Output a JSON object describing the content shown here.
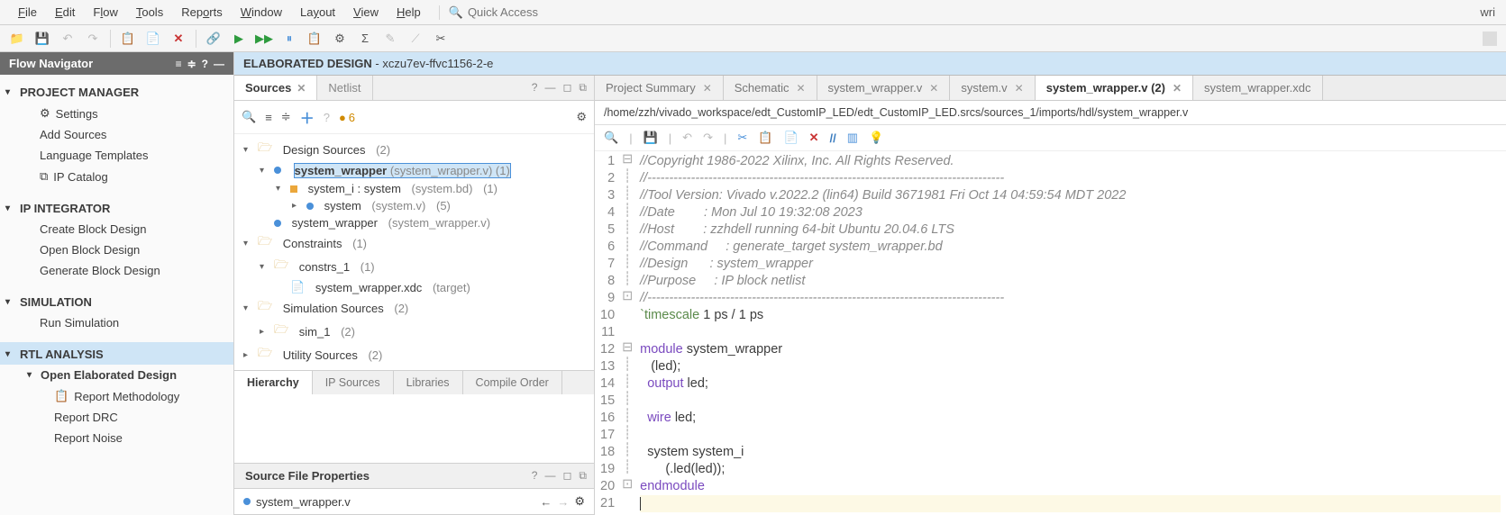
{
  "menu": {
    "file": "File",
    "edit": "Edit",
    "flow": "Flow",
    "tools": "Tools",
    "reports": "Reports",
    "window": "Window",
    "layout": "Layout",
    "view": "View",
    "help": "Help"
  },
  "quick_access": {
    "placeholder": "Quick Access"
  },
  "right_text": "wri",
  "flow_nav": {
    "title": "Flow Navigator",
    "project_manager": "PROJECT MANAGER",
    "settings": "Settings",
    "add_sources": "Add Sources",
    "language_templates": "Language Templates",
    "ip_catalog": "IP Catalog",
    "ip_integrator": "IP INTEGRATOR",
    "create_block": "Create Block Design",
    "open_block": "Open Block Design",
    "generate_block": "Generate Block Design",
    "simulation": "SIMULATION",
    "run_simulation": "Run Simulation",
    "rtl_analysis": "RTL ANALYSIS",
    "open_elab": "Open Elaborated Design",
    "report_methodology": "Report Methodology",
    "report_drc": "Report DRC",
    "report_noise": "Report Noise"
  },
  "elab": {
    "title": "ELABORATED DESIGN",
    "part": " - xczu7ev-ffvc1156-2-e"
  },
  "sources": {
    "tab": "Sources",
    "netlist": "Netlist",
    "warn_count": "6",
    "design_sources": "Design Sources",
    "ds_count": "(2)",
    "system_wrapper": "system_wrapper",
    "system_wrapper_file": "(system_wrapper.v)",
    "sw_count": "(1)",
    "system_i": "system_i : system",
    "system_i_file": "(system.bd)",
    "si_count": "(1)",
    "system": "system",
    "system_file": "(system.v)",
    "s_count": "(5)",
    "system_wrapper2": "system_wrapper",
    "system_wrapper2_file": "(system_wrapper.v)",
    "constraints": "Constraints",
    "c_count": "(1)",
    "constrs_1": "constrs_1",
    "c1_count": "(1)",
    "xdc": "system_wrapper.xdc",
    "xdc_note": "(target)",
    "sim_sources": "Simulation Sources",
    "ss_count": "(2)",
    "sim_1": "sim_1",
    "s1_count": "(2)",
    "utility_sources": "Utility Sources",
    "us_count": "(2)",
    "hierarchy": "Hierarchy",
    "ip_sources": "IP Sources",
    "libraries": "Libraries",
    "compile_order": "Compile Order"
  },
  "props": {
    "title": "Source File Properties",
    "file": "system_wrapper.v"
  },
  "editor": {
    "tabs": {
      "summary": "Project Summary",
      "schematic": "Schematic",
      "swv": "system_wrapper.v",
      "sysv": "system.v",
      "swv2": "system_wrapper.v (2)",
      "xdc": "system_wrapper.xdc"
    },
    "path": "/home/zzh/vivado_workspace/edt_CustomIP_LED/edt_CustomIP_LED.srcs/sources_1/imports/hdl/system_wrapper.v",
    "code": {
      "l1": "//Copyright 1986-2022 Xilinx, Inc. All Rights Reserved.",
      "l2": "//----------------------------------------------------------------------------------",
      "l3": "//Tool Version: Vivado v.2022.2 (lin64) Build 3671981 Fri Oct 14 04:59:54 MDT 2022",
      "l4": "//Date        : Mon Jul 10 19:32:08 2023",
      "l5": "//Host        : zzhdell running 64-bit Ubuntu 20.04.6 LTS",
      "l6": "//Command     : generate_target system_wrapper.bd",
      "l7": "//Design      : system_wrapper",
      "l8": "//Purpose     : IP block netlist",
      "l9": "//----------------------------------------------------------------------------------",
      "l10a": "`timescale",
      "l10b": " 1 ps / 1 ps",
      "l12a": "module",
      "l12b": " system_wrapper",
      "l13": "   (led);",
      "l14a": "  output",
      "l14b": " led;",
      "l16a": "  wire",
      "l16b": " led;",
      "l18": "  system system_i",
      "l19": "       (.led(led));",
      "l20": "endmodule"
    }
  }
}
